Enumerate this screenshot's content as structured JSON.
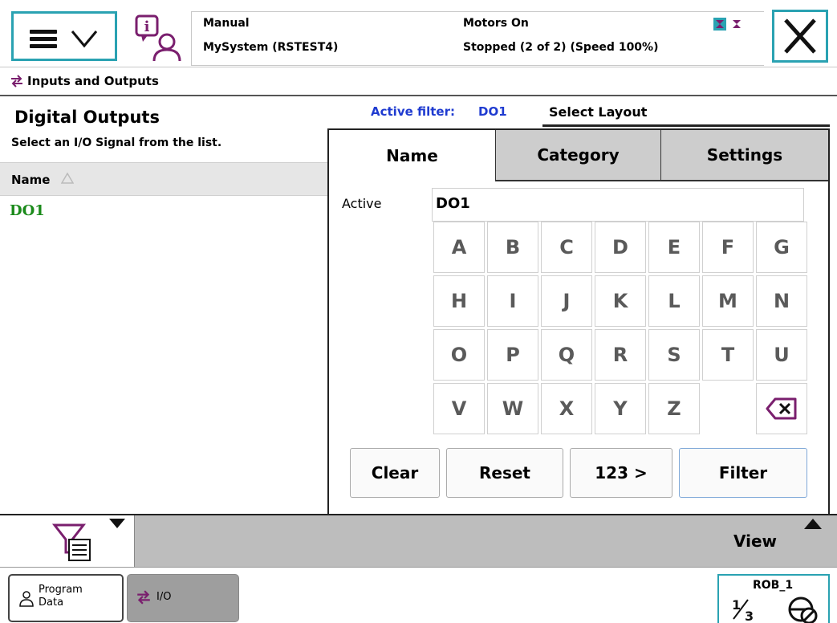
{
  "header": {
    "operating_mode": "Manual",
    "system_name": "MySystem (RSTEST4)",
    "motors_state": "Motors On",
    "program_state": "Stopped (2 of 2) (Speed 100%)"
  },
  "window": {
    "title": "Inputs and Outputs"
  },
  "left_panel": {
    "title": "Digital Outputs",
    "subtitle": "Select an I/O Signal from the list.",
    "column_header": "Name",
    "signals": [
      "DO1"
    ]
  },
  "filter": {
    "active_filter_label": "Active filter:",
    "active_filter_value": "DO1",
    "select_layout_label": "Select Layout",
    "tabs": [
      {
        "label": "Name",
        "selected": true
      },
      {
        "label": "Category",
        "selected": false
      },
      {
        "label": "Settings",
        "selected": false
      }
    ],
    "active_label": "Active",
    "active_value": "DO1",
    "keys": [
      "A",
      "B",
      "C",
      "D",
      "E",
      "F",
      "G",
      "H",
      "I",
      "J",
      "K",
      "L",
      "M",
      "N",
      "O",
      "P",
      "Q",
      "R",
      "S",
      "T",
      "U",
      "V",
      "W",
      "X",
      "Y",
      "Z"
    ],
    "buttons": {
      "clear": "Clear",
      "reset": "Reset",
      "numeric": "123 >",
      "filter": "Filter"
    }
  },
  "command_bar": {
    "view_label": "View"
  },
  "taskbar": {
    "program_data_line1": "Program",
    "program_data_line2": "Data",
    "io_label": "I/O",
    "rob_label": "ROB_1",
    "speed_fraction_label": "1/3"
  },
  "colors": {
    "accent_teal": "#2aa2b2",
    "signal_green": "#1a8a1a",
    "filter_blue": "#1f3bd0",
    "icon_purple": "#7a1f6e"
  },
  "icons": [
    "menu-icon",
    "chevron-down-icon",
    "info-person-icon",
    "io-arrows-icon",
    "close-icon",
    "sort-ascending-icon",
    "backspace-icon",
    "filter-icon",
    "triangle-down-icon",
    "triangle-up-icon",
    "program-data-icon",
    "speed-fraction-icon",
    "robot-mechanical-unit-icon"
  ]
}
